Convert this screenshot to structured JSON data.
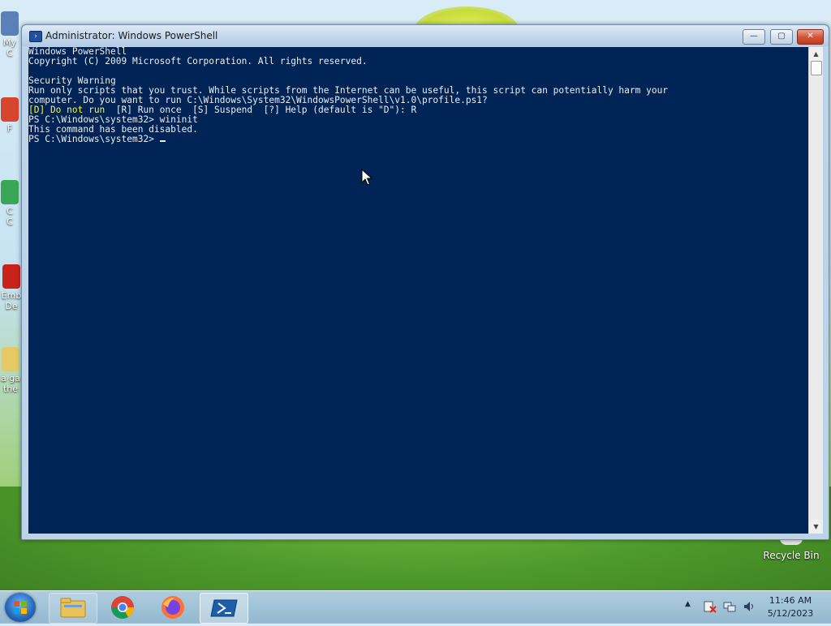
{
  "window": {
    "title": "Administrator: Windows PowerShell",
    "minimize_label": "—",
    "maximize_label": "▢",
    "close_label": "✕"
  },
  "console": {
    "lines": [
      "Windows PowerShell",
      "Copyright (C) 2009 Microsoft Corporation. All rights reserved.",
      "",
      "Security Warning",
      "Run only scripts that you trust. While scripts from the Internet can be useful, this script can potentially harm your",
      "computer. Do you want to run C:\\Windows\\System32\\WindowsPowerShell\\v1.0\\profile.ps1?"
    ],
    "prompt_highlight": "[D] Do not run",
    "prompt_rest": "  [R] Run once  [S] Suspend  [?] Help (default is \"D\"): R",
    "lines_after": [
      "PS C:\\Windows\\system32> wininit",
      "This command has been disabled."
    ],
    "current_prompt": "PS C:\\Windows\\system32> ",
    "background_color": "#012456",
    "text_color": "#eeedf0",
    "highlight_color": "#f5f542"
  },
  "desktop": {
    "recycle_bin_label": "Recycle Bin",
    "partial_icon_labels": [
      "My C",
      "F",
      "C",
      "C",
      "Emb",
      "De",
      "a ga",
      "the"
    ]
  },
  "taskbar": {
    "items": [
      "start-button",
      "file-explorer",
      "chrome",
      "firefox",
      "powershell"
    ],
    "clock_time": "11:46 AM",
    "clock_date": "5/12/2023",
    "tray_expand_label": "▲"
  }
}
